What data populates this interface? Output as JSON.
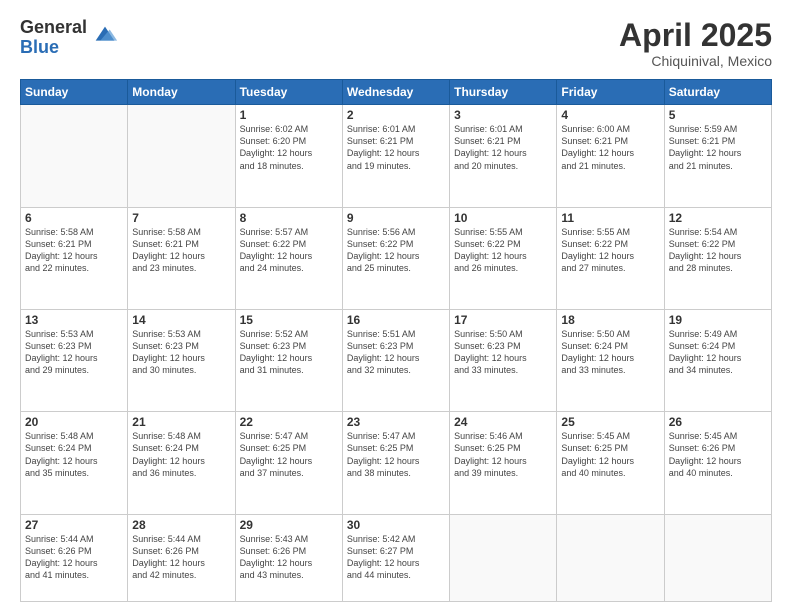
{
  "logo": {
    "general": "General",
    "blue": "Blue"
  },
  "header": {
    "month": "April 2025",
    "location": "Chiquinival, Mexico"
  },
  "weekdays": [
    "Sunday",
    "Monday",
    "Tuesday",
    "Wednesday",
    "Thursday",
    "Friday",
    "Saturday"
  ],
  "weeks": [
    [
      {
        "day": "",
        "info": ""
      },
      {
        "day": "",
        "info": ""
      },
      {
        "day": "1",
        "info": "Sunrise: 6:02 AM\nSunset: 6:20 PM\nDaylight: 12 hours\nand 18 minutes."
      },
      {
        "day": "2",
        "info": "Sunrise: 6:01 AM\nSunset: 6:21 PM\nDaylight: 12 hours\nand 19 minutes."
      },
      {
        "day": "3",
        "info": "Sunrise: 6:01 AM\nSunset: 6:21 PM\nDaylight: 12 hours\nand 20 minutes."
      },
      {
        "day": "4",
        "info": "Sunrise: 6:00 AM\nSunset: 6:21 PM\nDaylight: 12 hours\nand 21 minutes."
      },
      {
        "day": "5",
        "info": "Sunrise: 5:59 AM\nSunset: 6:21 PM\nDaylight: 12 hours\nand 21 minutes."
      }
    ],
    [
      {
        "day": "6",
        "info": "Sunrise: 5:58 AM\nSunset: 6:21 PM\nDaylight: 12 hours\nand 22 minutes."
      },
      {
        "day": "7",
        "info": "Sunrise: 5:58 AM\nSunset: 6:21 PM\nDaylight: 12 hours\nand 23 minutes."
      },
      {
        "day": "8",
        "info": "Sunrise: 5:57 AM\nSunset: 6:22 PM\nDaylight: 12 hours\nand 24 minutes."
      },
      {
        "day": "9",
        "info": "Sunrise: 5:56 AM\nSunset: 6:22 PM\nDaylight: 12 hours\nand 25 minutes."
      },
      {
        "day": "10",
        "info": "Sunrise: 5:55 AM\nSunset: 6:22 PM\nDaylight: 12 hours\nand 26 minutes."
      },
      {
        "day": "11",
        "info": "Sunrise: 5:55 AM\nSunset: 6:22 PM\nDaylight: 12 hours\nand 27 minutes."
      },
      {
        "day": "12",
        "info": "Sunrise: 5:54 AM\nSunset: 6:22 PM\nDaylight: 12 hours\nand 28 minutes."
      }
    ],
    [
      {
        "day": "13",
        "info": "Sunrise: 5:53 AM\nSunset: 6:23 PM\nDaylight: 12 hours\nand 29 minutes."
      },
      {
        "day": "14",
        "info": "Sunrise: 5:53 AM\nSunset: 6:23 PM\nDaylight: 12 hours\nand 30 minutes."
      },
      {
        "day": "15",
        "info": "Sunrise: 5:52 AM\nSunset: 6:23 PM\nDaylight: 12 hours\nand 31 minutes."
      },
      {
        "day": "16",
        "info": "Sunrise: 5:51 AM\nSunset: 6:23 PM\nDaylight: 12 hours\nand 32 minutes."
      },
      {
        "day": "17",
        "info": "Sunrise: 5:50 AM\nSunset: 6:23 PM\nDaylight: 12 hours\nand 33 minutes."
      },
      {
        "day": "18",
        "info": "Sunrise: 5:50 AM\nSunset: 6:24 PM\nDaylight: 12 hours\nand 33 minutes."
      },
      {
        "day": "19",
        "info": "Sunrise: 5:49 AM\nSunset: 6:24 PM\nDaylight: 12 hours\nand 34 minutes."
      }
    ],
    [
      {
        "day": "20",
        "info": "Sunrise: 5:48 AM\nSunset: 6:24 PM\nDaylight: 12 hours\nand 35 minutes."
      },
      {
        "day": "21",
        "info": "Sunrise: 5:48 AM\nSunset: 6:24 PM\nDaylight: 12 hours\nand 36 minutes."
      },
      {
        "day": "22",
        "info": "Sunrise: 5:47 AM\nSunset: 6:25 PM\nDaylight: 12 hours\nand 37 minutes."
      },
      {
        "day": "23",
        "info": "Sunrise: 5:47 AM\nSunset: 6:25 PM\nDaylight: 12 hours\nand 38 minutes."
      },
      {
        "day": "24",
        "info": "Sunrise: 5:46 AM\nSunset: 6:25 PM\nDaylight: 12 hours\nand 39 minutes."
      },
      {
        "day": "25",
        "info": "Sunrise: 5:45 AM\nSunset: 6:25 PM\nDaylight: 12 hours\nand 40 minutes."
      },
      {
        "day": "26",
        "info": "Sunrise: 5:45 AM\nSunset: 6:26 PM\nDaylight: 12 hours\nand 40 minutes."
      }
    ],
    [
      {
        "day": "27",
        "info": "Sunrise: 5:44 AM\nSunset: 6:26 PM\nDaylight: 12 hours\nand 41 minutes."
      },
      {
        "day": "28",
        "info": "Sunrise: 5:44 AM\nSunset: 6:26 PM\nDaylight: 12 hours\nand 42 minutes."
      },
      {
        "day": "29",
        "info": "Sunrise: 5:43 AM\nSunset: 6:26 PM\nDaylight: 12 hours\nand 43 minutes."
      },
      {
        "day": "30",
        "info": "Sunrise: 5:42 AM\nSunset: 6:27 PM\nDaylight: 12 hours\nand 44 minutes."
      },
      {
        "day": "",
        "info": ""
      },
      {
        "day": "",
        "info": ""
      },
      {
        "day": "",
        "info": ""
      }
    ]
  ]
}
